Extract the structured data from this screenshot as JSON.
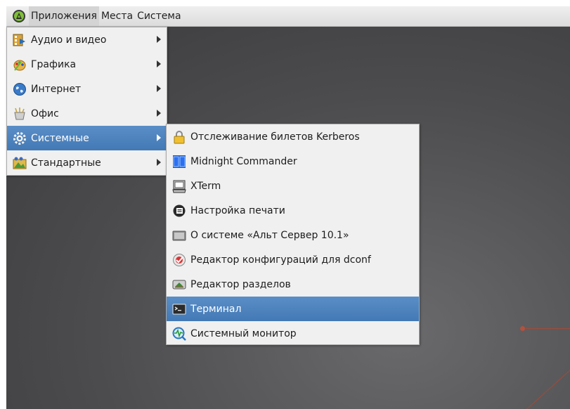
{
  "topbar": {
    "menus": [
      "Приложения",
      "Места",
      "Система"
    ]
  },
  "apps_menu": {
    "items": [
      {
        "label": "Аудио и видео",
        "icon": "multimedia-icon"
      },
      {
        "label": "Графика",
        "icon": "graphics-icon"
      },
      {
        "label": "Интернет",
        "icon": "internet-globe-icon"
      },
      {
        "label": "Офис",
        "icon": "office-icon"
      },
      {
        "label": "Системные",
        "icon": "system-gear-icon"
      },
      {
        "label": "Стандартные",
        "icon": "accessories-icon"
      }
    ],
    "selected_index": 4
  },
  "system_submenu": {
    "items": [
      {
        "label": "Отслеживание билетов Kerberos",
        "icon": "lock-icon"
      },
      {
        "label": "Midnight Commander",
        "icon": "midnight-commander-icon"
      },
      {
        "label": "XTerm",
        "icon": "xterm-icon"
      },
      {
        "label": "Настройка печати",
        "icon": "printer-settings-icon"
      },
      {
        "label": "О системе «Альт Сервер 10.1»",
        "icon": "about-system-icon"
      },
      {
        "label": "Редактор конфигураций для dconf",
        "icon": "dconf-editor-icon"
      },
      {
        "label": "Редактор разделов",
        "icon": "partition-editor-icon"
      },
      {
        "label": "Терминал",
        "icon": "terminal-icon"
      },
      {
        "label": "Системный монитор",
        "icon": "system-monitor-icon"
      }
    ],
    "selected_index": 7
  },
  "colors": {
    "selection": "#4a80bd",
    "accent_decor": "#b8462e"
  }
}
